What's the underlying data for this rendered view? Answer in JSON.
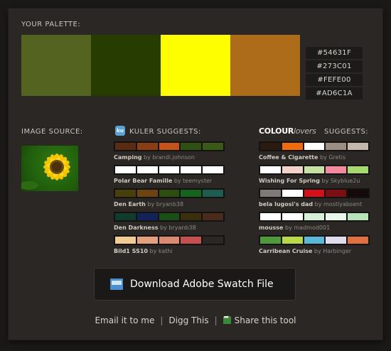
{
  "palette": {
    "heading": "YOUR PALETTE:",
    "colors": [
      "#54631F",
      "#273C01",
      "#FEFE00",
      "#AD6C1A"
    ]
  },
  "image_source": {
    "heading": "IMAGE SOURCE:"
  },
  "kuler": {
    "badge": "ku",
    "heading": "KULER SUGGESTS:",
    "items": [
      {
        "name": "Camping",
        "by": "by",
        "author": "brandi.johnson",
        "colors": [
          "#5a2c12",
          "#8a3e12",
          "#c3521b",
          "#2f5012",
          "#3c5a17"
        ]
      },
      {
        "name": "Polar Bear Famille",
        "by": "by",
        "author": "teemyster",
        "colors": [
          "#ffffff",
          "#ffffff",
          "#ffffff",
          "#ffffff",
          "#ffffff"
        ]
      },
      {
        "name": "Den Earth",
        "by": "by",
        "author": "bryanb38",
        "colors": [
          "#48400b",
          "#6b4412",
          "#2d4e10",
          "#16621f",
          "#1f5c52"
        ]
      },
      {
        "name": "Den Darkness",
        "by": "by",
        "author": "bryanb38",
        "colors": [
          "#0f3c2c",
          "#14225a",
          "#1b4e16",
          "#3a2f0c",
          "#4a2a1a"
        ]
      },
      {
        "name": "Bild1 SS10",
        "by": "by",
        "author": "kathi",
        "colors": [
          "#f2cc93",
          "#e5a07d",
          "#d98a70",
          "#c55050",
          "#2a2724"
        ]
      }
    ]
  },
  "colourlovers": {
    "logo_main": "COLOUR",
    "logo_sub": "lovers",
    "heading": "SUGGESTS:",
    "items": [
      {
        "name": "Coffee & Cigarette",
        "by": "by",
        "author": "Gretis",
        "colors": [
          "#2a1a10",
          "#f06a10",
          "#ffffff",
          "#9c8e82",
          "#c2b8ac"
        ]
      },
      {
        "name": "Wishing For Spring",
        "by": "by",
        "author": "Skyblue2u",
        "colors": [
          "#ffffff",
          "#f2d2cb",
          "#c6e0a5",
          "#f28aa0",
          "#a8d870"
        ]
      },
      {
        "name": "bela lugosi's dad",
        "by": "by",
        "author": "mostlyabsent",
        "colors": [
          "#7e7a76",
          "#ffffff",
          "#d4101a",
          "#7a0f14",
          "#150a08"
        ]
      },
      {
        "name": "mousse",
        "by": "by",
        "author": "madmod001",
        "colors": [
          "#ffffff",
          "#ffffff",
          "#d6f0d8",
          "#eaf6ea",
          "#b8e2b8"
        ]
      },
      {
        "name": "Carribean Cruise",
        "by": "by",
        "author": "Harbinger",
        "colors": [
          "#4f9a3a",
          "#b8d84a",
          "#5cb8d8",
          "#e0dcef",
          "#e07040"
        ]
      }
    ]
  },
  "download": {
    "label": "Download Adobe Swatch File",
    "icon": "swatch-file-icon"
  },
  "footer": {
    "email": "Email it to me",
    "digg": "Digg This",
    "share": "Share this tool",
    "separator": "|"
  }
}
